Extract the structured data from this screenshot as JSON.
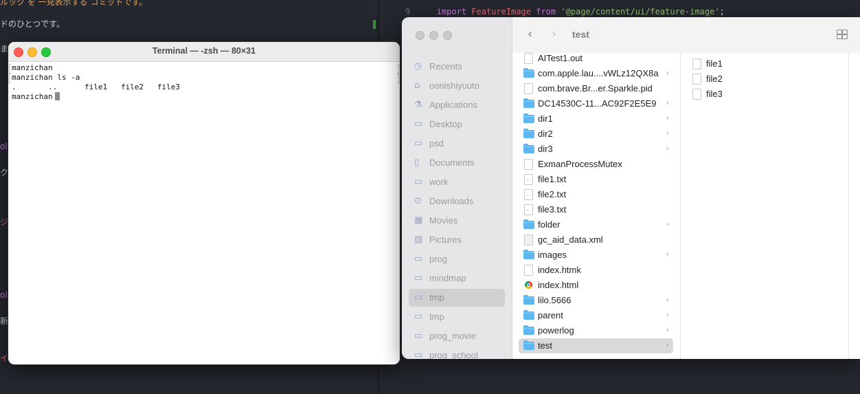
{
  "editor": {
    "left_lines": [
      "ルック を 一見表示する コミットです。",
      "ドのひとつです。",
      "ま",
      "ol",
      "ク",
      "ジ",
      "ol",
      "新",
      "イ"
    ],
    "line_number": "9",
    "code": {
      "kw_import": "import",
      "identifier": "FeatureImage",
      "kw_from": "from",
      "module": "'@page/content/ui/feature-image'",
      "semicolon": ";"
    }
  },
  "terminal": {
    "title": "Terminal — -zsh — 80×31",
    "lines": [
      "manzichan",
      "manzichan ls -a",
      ".       ..      file1   file2   file3",
      "manzichan"
    ]
  },
  "finder": {
    "folder_title": "test",
    "sidebar": [
      {
        "label": "Recents",
        "icon": "clock-icon"
      },
      {
        "label": "oonishiyuuto",
        "icon": "home-icon"
      },
      {
        "label": "Applications",
        "icon": "applications-icon"
      },
      {
        "label": "Desktop",
        "icon": "desktop-icon"
      },
      {
        "label": "psd",
        "icon": "folder-icon"
      },
      {
        "label": "Documents",
        "icon": "document-icon"
      },
      {
        "label": "work",
        "icon": "folder-icon"
      },
      {
        "label": "Downloads",
        "icon": "download-icon"
      },
      {
        "label": "Movies",
        "icon": "film-icon"
      },
      {
        "label": "Pictures",
        "icon": "photo-icon"
      },
      {
        "label": "prog",
        "icon": "folder-icon"
      },
      {
        "label": "mindmap",
        "icon": "folder-icon"
      },
      {
        "label": "tmp",
        "icon": "folder-icon",
        "selected": true
      },
      {
        "label": "tmp",
        "icon": "folder-icon"
      },
      {
        "label": "prog_movie",
        "icon": "folder-icon"
      },
      {
        "label": "prog_school",
        "icon": "folder-icon"
      }
    ],
    "column1": [
      {
        "name": "AITest1.out",
        "kind": "file"
      },
      {
        "name": "com.apple.lau....vWLz12QX8a",
        "kind": "folder"
      },
      {
        "name": "com.brave.Br...er.Sparkle.pid",
        "kind": "file"
      },
      {
        "name": "DC14530C-11...AC92F2E5E9",
        "kind": "folder"
      },
      {
        "name": "dir1",
        "kind": "folder"
      },
      {
        "name": "dir2",
        "kind": "folder"
      },
      {
        "name": "dir3",
        "kind": "folder"
      },
      {
        "name": "ExmanProcessMutex",
        "kind": "file"
      },
      {
        "name": "file1.txt",
        "kind": "txt"
      },
      {
        "name": "file2.txt",
        "kind": "txt"
      },
      {
        "name": "file3.txt",
        "kind": "txt"
      },
      {
        "name": "folder",
        "kind": "folder"
      },
      {
        "name": "gc_aid_data.xml",
        "kind": "xml"
      },
      {
        "name": "images",
        "kind": "folder"
      },
      {
        "name": "index.htmk",
        "kind": "file"
      },
      {
        "name": "index.html",
        "kind": "html"
      },
      {
        "name": "lilo.5666",
        "kind": "folder"
      },
      {
        "name": "parent",
        "kind": "folder"
      },
      {
        "name": "powerlog",
        "kind": "folder"
      },
      {
        "name": "test",
        "kind": "folder",
        "selected": true
      }
    ],
    "column2": [
      {
        "name": "file1",
        "kind": "file"
      },
      {
        "name": "file2",
        "kind": "file"
      },
      {
        "name": "file3",
        "kind": "file"
      }
    ],
    "colors": {
      "folder": "#5fb7ef",
      "selection": "#d9d9dc"
    }
  }
}
